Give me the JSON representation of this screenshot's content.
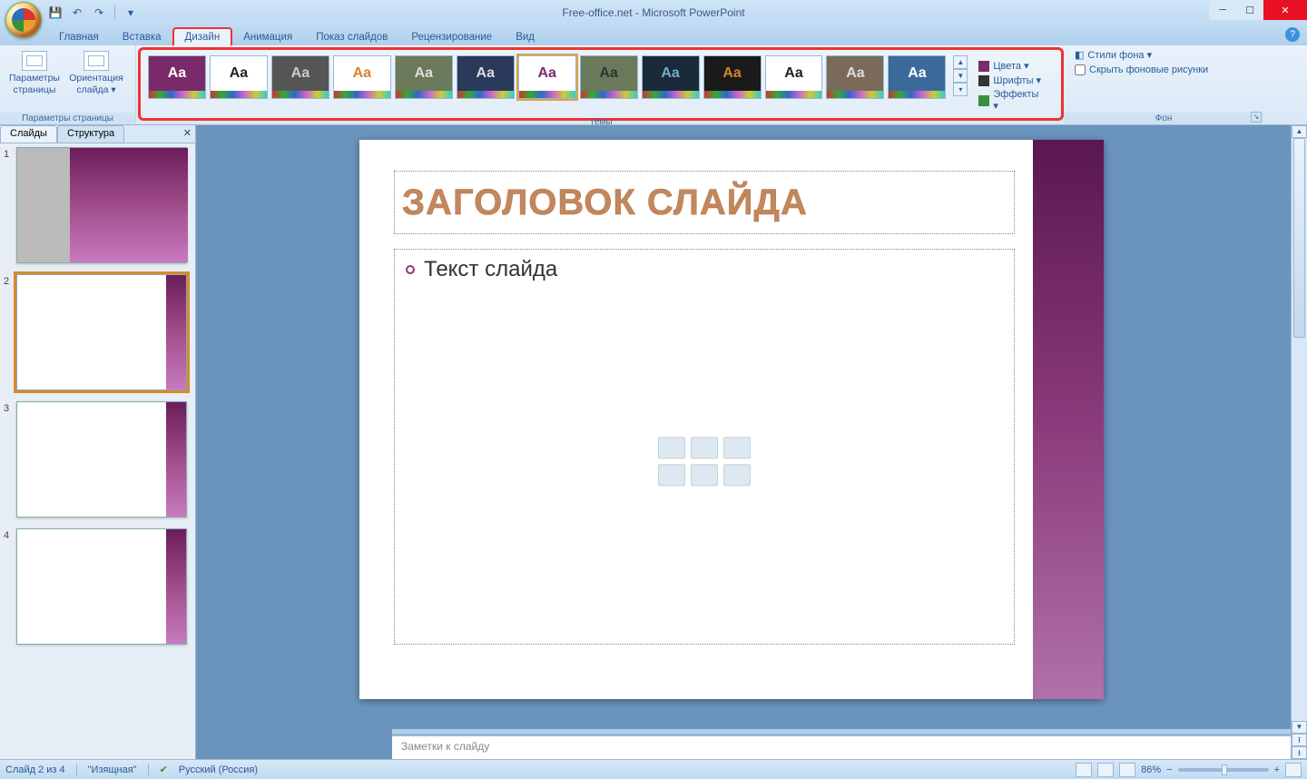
{
  "title": "Free-office.net - Microsoft PowerPoint",
  "tabs": [
    "Главная",
    "Вставка",
    "Дизайн",
    "Анимация",
    "Показ слайдов",
    "Рецензирование",
    "Вид"
  ],
  "active_tab_index": 2,
  "page_setup": {
    "page_params": "Параметры\nстраницы",
    "orientation": "Ориентация\nслайда ▾",
    "group_label": "Параметры страницы"
  },
  "themes_group_label": "Темы",
  "theme_options": {
    "colors": "Цвета ▾",
    "fonts": "Шрифты ▾",
    "effects": "Эффекты ▾"
  },
  "background": {
    "styles": "Стили фона ▾",
    "hide": "Скрыть фоновые рисунки",
    "group_label": "Фон"
  },
  "left_panel": {
    "tab_slides": "Слайды",
    "tab_outline": "Структура"
  },
  "thumbs": [
    1,
    2,
    3,
    4
  ],
  "selected_thumb": 2,
  "slide": {
    "title": "ЗАГОЛОВОК СЛАЙДА",
    "body": "Текст слайда"
  },
  "notes_placeholder": "Заметки к слайду",
  "status": {
    "slide_of": "Слайд 2 из 4",
    "theme": "\"Изящная\"",
    "lang": "Русский (Россия)",
    "zoom": "86%"
  },
  "themes": [
    {
      "bg": "#7a2a6a",
      "fg": "#fff"
    },
    {
      "bg": "#fff",
      "fg": "#222"
    },
    {
      "bg": "#555",
      "fg": "#ccc"
    },
    {
      "bg": "#fff",
      "fg": "#d9822a"
    },
    {
      "bg": "#6a7a5a",
      "fg": "#ddd"
    },
    {
      "bg": "#2a3a5a",
      "fg": "#ddd"
    },
    {
      "bg": "#fff",
      "fg": "#7a2a6a",
      "sel": true
    },
    {
      "bg": "#6a7a5a",
      "fg": "#333"
    },
    {
      "bg": "#1a2a3a",
      "fg": "#7ac"
    },
    {
      "bg": "#1a1a1a",
      "fg": "#d9822a"
    },
    {
      "bg": "#fff",
      "fg": "#222"
    },
    {
      "bg": "#7a6a5a",
      "fg": "#ddd"
    },
    {
      "bg": "#3a6a9a",
      "fg": "#fff"
    }
  ]
}
